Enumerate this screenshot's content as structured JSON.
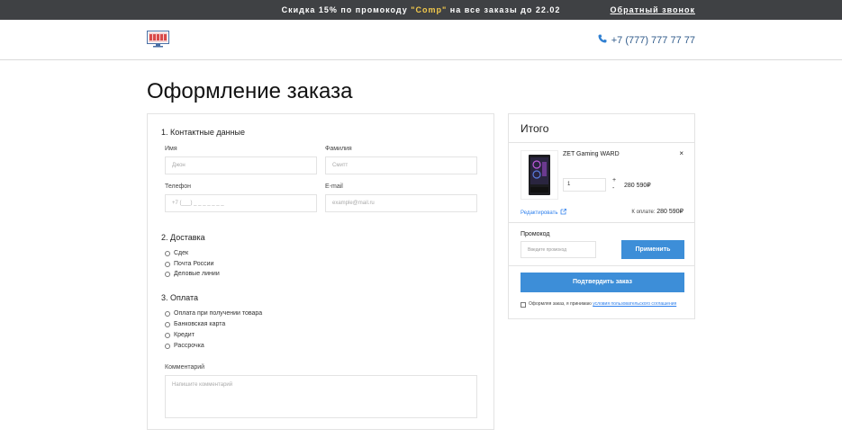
{
  "topbar": {
    "promo_before": "Скидка 15% по промокоду ",
    "promo_code": "\"Comp\"",
    "promo_after": " на все заказы до 22.02",
    "callback": "Обратный звонок"
  },
  "header": {
    "phone": "+7 (777) 777 77 77",
    "logo_icon": "monitor-logo-icon"
  },
  "page_title": "Оформление заказа",
  "contacts": {
    "title": "1. Контактные данные",
    "name_label": "Имя",
    "name_placeholder": "Джон",
    "surname_label": "Фамилия",
    "surname_placeholder": "Смитт",
    "phone_label": "Телефон",
    "phone_placeholder": "+7 (___) _ _ _ _ _ _ _",
    "email_label": "E-mail",
    "email_placeholder": "example@mail.ru"
  },
  "delivery": {
    "title": "2. Доставка",
    "options": [
      "Сдек",
      "Почта России",
      "Деловые линии"
    ]
  },
  "payment": {
    "title": "3. Оплата",
    "options": [
      "Оплата при получении товара",
      "Банковская карта",
      "Кредит",
      "Рассрочка"
    ]
  },
  "comment": {
    "label": "Комментарий",
    "placeholder": "Напишите комментарий"
  },
  "summary": {
    "title": "Итого",
    "product_name": "ZET Gaming WARD",
    "remove": "×",
    "qty": "1",
    "plus": "+",
    "minus": "-",
    "price": "280 590₽",
    "edit": "Редактировать",
    "to_pay_label": "К оплате:",
    "to_pay_value": "280 590₽",
    "promo_label": "Промокод",
    "promo_placeholder": "Введите промокод",
    "apply": "Применить",
    "confirm": "Подтвердить заказ",
    "agree_text": "Оформляя заказ, я принимаю ",
    "agree_link": "условия пользовательского соглашения"
  },
  "colors": {
    "topbar": "#3f4144",
    "promo_code": "#f2c94c",
    "accent": "#3d8ed8",
    "link": "#2f80ed"
  }
}
